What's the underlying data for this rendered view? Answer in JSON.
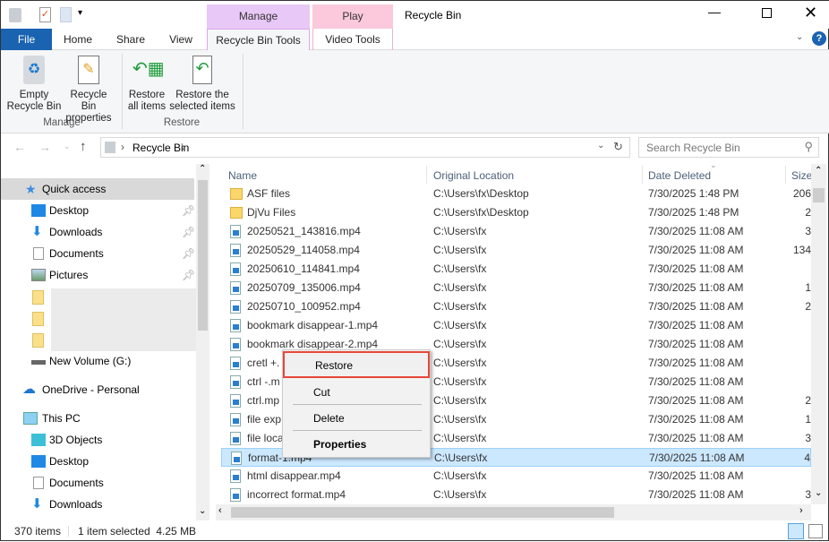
{
  "window": {
    "title": "Recycle Bin"
  },
  "context_tabs": {
    "manage": "Manage",
    "play": "Play",
    "colors": {
      "manage": "#e8c8f6",
      "play": "#fbc8dc"
    }
  },
  "tabs": [
    "File",
    "Home",
    "Share",
    "View",
    "Recycle Bin Tools",
    "Video Tools"
  ],
  "ribbon": {
    "buttons": [
      {
        "l1": "Empty",
        "l2": "Recycle Bin"
      },
      {
        "l1": "Recycle Bin",
        "l2": "properties"
      },
      {
        "l1": "Restore",
        "l2": "all items"
      },
      {
        "l1": "Restore the",
        "l2": "selected items"
      }
    ],
    "groups": [
      "Manage",
      "Restore"
    ]
  },
  "address": {
    "path": "Recycle Bin",
    "search_placeholder": "Search Recycle Bin"
  },
  "nav": {
    "quick_access": "Quick access",
    "items": [
      "Desktop",
      "Downloads",
      "Documents",
      "Pictures"
    ],
    "new_volume": "New Volume (G:)",
    "onedrive": "OneDrive - Personal",
    "this_pc": "This PC",
    "pc_items": [
      "3D Objects",
      "Desktop",
      "Documents",
      "Downloads"
    ]
  },
  "columns": {
    "name": "Name",
    "location": "Original Location",
    "date": "Date Deleted",
    "size": "Size"
  },
  "rows": [
    {
      "name": "ASF files",
      "loc": "C:\\Users\\fx\\Desktop",
      "date": "7/30/2025 1:48 PM",
      "size": "206",
      "type": "folder"
    },
    {
      "name": "DjVu Files",
      "loc": "C:\\Users\\fx\\Desktop",
      "date": "7/30/2025 1:48 PM",
      "size": "2",
      "type": "folder"
    },
    {
      "name": "20250521_143816.mp4",
      "loc": "C:\\Users\\fx",
      "date": "7/30/2025 11:08 AM",
      "size": "3",
      "type": "video"
    },
    {
      "name": "20250529_114058.mp4",
      "loc": "C:\\Users\\fx",
      "date": "7/30/2025 11:08 AM",
      "size": "134",
      "type": "video"
    },
    {
      "name": "20250610_114841.mp4",
      "loc": "C:\\Users\\fx",
      "date": "7/30/2025 11:08 AM",
      "size": "",
      "type": "video"
    },
    {
      "name": "20250709_135006.mp4",
      "loc": "C:\\Users\\fx",
      "date": "7/30/2025 11:08 AM",
      "size": "1",
      "type": "video"
    },
    {
      "name": "20250710_100952.mp4",
      "loc": "C:\\Users\\fx",
      "date": "7/30/2025 11:08 AM",
      "size": "2",
      "type": "video"
    },
    {
      "name": "bookmark disappear-1.mp4",
      "loc": "C:\\Users\\fx",
      "date": "7/30/2025 11:08 AM",
      "size": "",
      "type": "video"
    },
    {
      "name": "bookmark disappear-2.mp4",
      "loc": "C:\\Users\\fx",
      "date": "7/30/2025 11:08 AM",
      "size": "",
      "type": "video"
    },
    {
      "name": "cretl +.",
      "loc": "C:\\Users\\fx",
      "date": "7/30/2025 11:08 AM",
      "size": "",
      "type": "video"
    },
    {
      "name": "ctrl -.m",
      "loc": "C:\\Users\\fx",
      "date": "7/30/2025 11:08 AM",
      "size": "",
      "type": "video"
    },
    {
      "name": "ctrl.mp",
      "loc": "C:\\Users\\fx",
      "date": "7/30/2025 11:08 AM",
      "size": "2",
      "type": "video"
    },
    {
      "name": "file exp",
      "loc": "C:\\Users\\fx",
      "date": "7/30/2025 11:08 AM",
      "size": "1",
      "type": "video"
    },
    {
      "name": "file loca",
      "loc": "C:\\Users\\fx",
      "date": "7/30/2025 11:08 AM",
      "size": "3",
      "type": "video"
    },
    {
      "name": "format-1.mp4",
      "loc": "C:\\Users\\fx",
      "date": "7/30/2025 11:08 AM",
      "size": "4",
      "type": "video",
      "selected": true
    },
    {
      "name": "html disappear.mp4",
      "loc": "C:\\Users\\fx",
      "date": "7/30/2025 11:08 AM",
      "size": "",
      "type": "video"
    },
    {
      "name": "incorrect format.mp4",
      "loc": "C:\\Users\\fx",
      "date": "7/30/2025 11:08 AM",
      "size": "3",
      "type": "video"
    }
  ],
  "context_menu": {
    "restore": "Restore",
    "cut": "Cut",
    "delete": "Delete",
    "properties": "Properties",
    "highlight_color": "#e8473a"
  },
  "status": {
    "count": "370 items",
    "selection": "1 item selected  4.25 MB"
  }
}
